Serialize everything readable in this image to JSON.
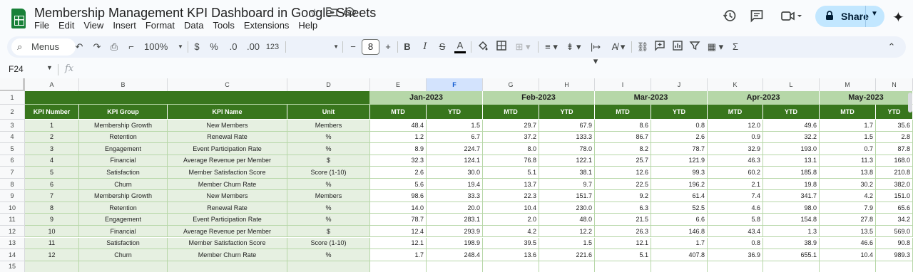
{
  "app": {
    "title": "Membership Management KPI Dashboard in Google Sheets",
    "menus": [
      "File",
      "Edit",
      "View",
      "Insert",
      "Format",
      "Data",
      "Tools",
      "Extensions",
      "Help"
    ],
    "share_label": "Share"
  },
  "toolbar": {
    "menus_label": "Menus",
    "zoom": "100%",
    "currency": "$",
    "percent": "%",
    "dec_decrease": ".0",
    "dec_increase": ".00",
    "number_format": "123",
    "font_size": "8"
  },
  "formula_bar": {
    "cell_ref": "F24",
    "fx": "fx",
    "value": ""
  },
  "grid": {
    "columns": [
      "A",
      "B",
      "C",
      "D",
      "E",
      "F",
      "G",
      "H",
      "I",
      "J",
      "K",
      "L",
      "M",
      "N"
    ],
    "selected_column": "F",
    "rows": [
      "1",
      "2",
      "3",
      "4",
      "5",
      "6",
      "7",
      "8",
      "9",
      "10",
      "11",
      "12",
      "13",
      "14",
      "15"
    ],
    "months": [
      "Jan-2023",
      "Feb-2023",
      "Mar-2023",
      "Apr-2023",
      "May-2023"
    ],
    "header_labels": [
      "KPI Number",
      "KPI Group",
      "KPI Name",
      "Unit"
    ],
    "mtd_label": "MTD",
    "ytd_label": "YTD",
    "kpis": [
      {
        "num": "1",
        "group": "Membership Growth",
        "name": "New Members",
        "unit": "Members",
        "vals": [
          "48.4",
          "1.5",
          "29.7",
          "67.9",
          "8.6",
          "0.8",
          "12.0",
          "49.6",
          "1.7",
          "35.6"
        ]
      },
      {
        "num": "2",
        "group": "Retention",
        "name": "Renewal Rate",
        "unit": "%",
        "vals": [
          "1.2",
          "6.7",
          "37.2",
          "133.3",
          "86.7",
          "2.6",
          "0.9",
          "32.2",
          "1.5",
          "2.8"
        ]
      },
      {
        "num": "3",
        "group": "Engagement",
        "name": "Event Participation Rate",
        "unit": "%",
        "vals": [
          "8.9",
          "224.7",
          "8.0",
          "78.0",
          "8.2",
          "78.7",
          "32.9",
          "193.0",
          "0.7",
          "87.8"
        ]
      },
      {
        "num": "4",
        "group": "Financial",
        "name": "Average Revenue per Member",
        "unit": "$",
        "vals": [
          "32.3",
          "124.1",
          "76.8",
          "122.1",
          "25.7",
          "121.9",
          "46.3",
          "13.1",
          "11.3",
          "168.0"
        ]
      },
      {
        "num": "5",
        "group": "Satisfaction",
        "name": "Member Satisfaction Score",
        "unit": "Score (1-10)",
        "vals": [
          "2.6",
          "30.0",
          "5.1",
          "38.1",
          "12.6",
          "99.3",
          "60.2",
          "185.8",
          "13.8",
          "210.8"
        ]
      },
      {
        "num": "6",
        "group": "Churn",
        "name": "Member Churn Rate",
        "unit": "%",
        "vals": [
          "5.6",
          "19.4",
          "13.7",
          "9.7",
          "22.5",
          "196.2",
          "2.1",
          "19.8",
          "30.2",
          "382.0"
        ]
      },
      {
        "num": "7",
        "group": "Membership Growth",
        "name": "New Members",
        "unit": "Members",
        "vals": [
          "98.6",
          "33.3",
          "22.3",
          "151.7",
          "9.2",
          "61.4",
          "7.4",
          "341.7",
          "4.2",
          "151.0"
        ]
      },
      {
        "num": "8",
        "group": "Retention",
        "name": "Renewal Rate",
        "unit": "%",
        "vals": [
          "14.0",
          "20.0",
          "10.4",
          "230.0",
          "6.3",
          "52.5",
          "4.6",
          "98.0",
          "7.9",
          "65.6"
        ]
      },
      {
        "num": "9",
        "group": "Engagement",
        "name": "Event Participation Rate",
        "unit": "%",
        "vals": [
          "78.7",
          "283.1",
          "2.0",
          "48.0",
          "21.5",
          "6.6",
          "5.8",
          "154.8",
          "27.8",
          "34.2"
        ]
      },
      {
        "num": "10",
        "group": "Financial",
        "name": "Average Revenue per Member",
        "unit": "$",
        "vals": [
          "12.4",
          "293.9",
          "4.2",
          "12.2",
          "26.3",
          "146.8",
          "43.4",
          "1.3",
          "13.5",
          "569.0"
        ]
      },
      {
        "num": "11",
        "group": "Satisfaction",
        "name": "Member Satisfaction Score",
        "unit": "Score (1-10)",
        "vals": [
          "12.1",
          "198.9",
          "39.5",
          "1.5",
          "12.1",
          "1.7",
          "0.8",
          "38.9",
          "46.6",
          "90.8"
        ]
      },
      {
        "num": "12",
        "group": "Churn",
        "name": "Member Churn Rate",
        "unit": "%",
        "vals": [
          "1.7",
          "248.4",
          "13.6",
          "221.6",
          "5.1",
          "407.8",
          "36.9",
          "655.1",
          "10.4",
          "989.3"
        ]
      }
    ]
  },
  "colors": {
    "dark_green": "#38761d",
    "light_green": "#b6d7a8",
    "pale_green": "#d9ead3",
    "row_green_bg": "#e6f0e1",
    "grid_line": "#b7d7a8",
    "selected_header": "#d3e3fd"
  },
  "icons": [
    "sheets-logo-icon",
    "star-icon",
    "move-folder-icon",
    "cloud-status-icon",
    "history-icon",
    "comment-icon",
    "meet-icon",
    "lock-icon",
    "gemini-icon",
    "search-icon",
    "undo-icon",
    "redo-icon",
    "print-icon",
    "paint-format-icon",
    "bold-icon",
    "italic-icon",
    "strikethrough-icon",
    "text-color-icon",
    "fill-color-icon",
    "borders-icon",
    "merge-icon",
    "align-icon",
    "valign-icon",
    "wrap-icon",
    "rotate-icon",
    "link-icon",
    "insert-comment-icon",
    "insert-chart-icon",
    "filter-icon",
    "filter-views-icon",
    "functions-icon",
    "collapse-icon"
  ]
}
